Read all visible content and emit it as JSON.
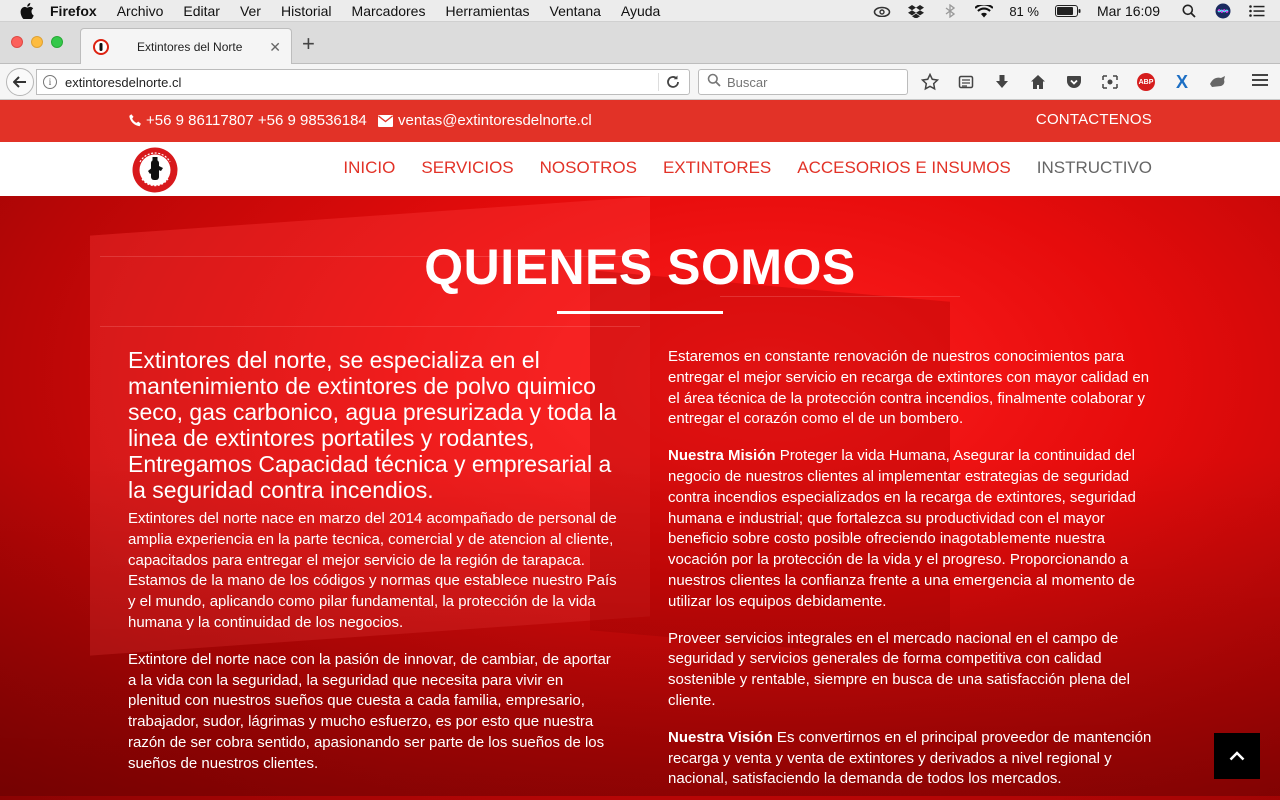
{
  "menubar": {
    "app": "Firefox",
    "items": [
      "Archivo",
      "Editar",
      "Ver",
      "Historial",
      "Marcadores",
      "Herramientas",
      "Ventana",
      "Ayuda"
    ],
    "battery": "81 %",
    "clock": "Mar 16:09"
  },
  "browser": {
    "tab_title": "Extintores del Norte",
    "url": "extintoresdelnorte.cl",
    "search_placeholder": "Buscar",
    "abp_label": "ABP",
    "x_label": "X"
  },
  "topbar": {
    "phones": "+56 9 86117807 +56 9 98536184",
    "email": "ventas@extintoresdelnorte.cl",
    "contact": "CONTACTENOS"
  },
  "nav": {
    "items": [
      "INICIO",
      "SERVICIOS",
      "NOSOTROS",
      "EXTINTORES",
      "ACCESORIOS E INSUMOS",
      "INSTRUCTIVO"
    ]
  },
  "hero": {
    "title": "QUIENES SOMOS",
    "left": {
      "lead": "Extintores del norte, se especializa en el mantenimiento de extintores de polvo quimico seco, gas carbonico, agua presurizada y toda la linea de extintores portatiles y rodantes, Entregamos Capacidad técnica y empresarial a la seguridad contra incendios.",
      "p1": "Extintores del norte nace en marzo del 2014 acompañado de personal de amplia experiencia en la parte tecnica, comercial y de atencion al cliente, capacitados para entregar el mejor servicio de la región de tarapaca. Estamos de la mano de los códigos y normas que establece nuestro País y el mundo, aplicando como pilar fundamental, la protección de la vida humana y la continuidad de los negocios.",
      "p2": "Extintore del norte nace con la pasión de innovar, de cambiar, de aportar a la vida con la seguridad, la seguridad que necesita para vivir en plenitud con nuestros sueños que cuesta a cada familia, empresario, trabajador, sudor, lágrimas y mucho esfuerzo, es por esto que nuestra razón de ser cobra sentido, apasionando ser parte de los sueños de los sueños de nuestros clientes."
    },
    "right": {
      "p1": "Estaremos en constante renovación de nuestros conocimientos para entregar el mejor servicio en recarga de extintores con mayor calidad en el área técnica de la protección contra incendios, finalmente colaborar y entregar el corazón como el de un bombero.",
      "mision_label": "Nuestra Misión",
      "mision_text": " Proteger la vida Humana, Asegurar la continuidad del negocio de nuestros clientes al implementar estrategias de seguridad contra incendios especializados en la recarga de extintores, seguridad humana e industrial; que fortalezca su productividad con el mayor beneficio sobre costo posible ofreciendo inagotablemente nuestra vocación por la protección de la vida y el progreso. Proporcionando a nuestros clientes la confianza frente a una emergencia al momento de utilizar los equipos debidamente.",
      "p3": "Proveer servicios integrales en el mercado nacional en el campo de seguridad y servicios generales de forma competitiva con calidad sostenible y rentable, siempre en busca de una satisfacción plena del cliente.",
      "vision_label": "Nuestra Visión",
      "vision_text": " Es convertirnos en el principal proveedor de mantención recarga y venta y venta de extintores y derivados a nivel regional y nacional, satisfaciendo la demanda de todos los mercados."
    }
  },
  "colors": {
    "brand_red": "#e23227",
    "hero_red": "#e60c0c",
    "nav_gray": "#666666"
  },
  "icons": [
    "apple-icon",
    "creative-cloud-icon",
    "dropbox-icon",
    "bluetooth-icon",
    "wifi-icon",
    "battery-icon",
    "spotlight-icon",
    "siri-icon",
    "notification-center-icon",
    "back-arrow-icon",
    "info-icon",
    "reload-icon",
    "search-icon",
    "bookmark-star-icon",
    "reading-list-icon",
    "download-icon",
    "home-icon",
    "pocket-icon",
    "screenshot-icon",
    "adblock-icon",
    "x-extension-icon",
    "extension-icon",
    "hamburger-menu-icon",
    "phone-icon",
    "mail-icon",
    "logo-icon",
    "chevron-up-icon"
  ]
}
